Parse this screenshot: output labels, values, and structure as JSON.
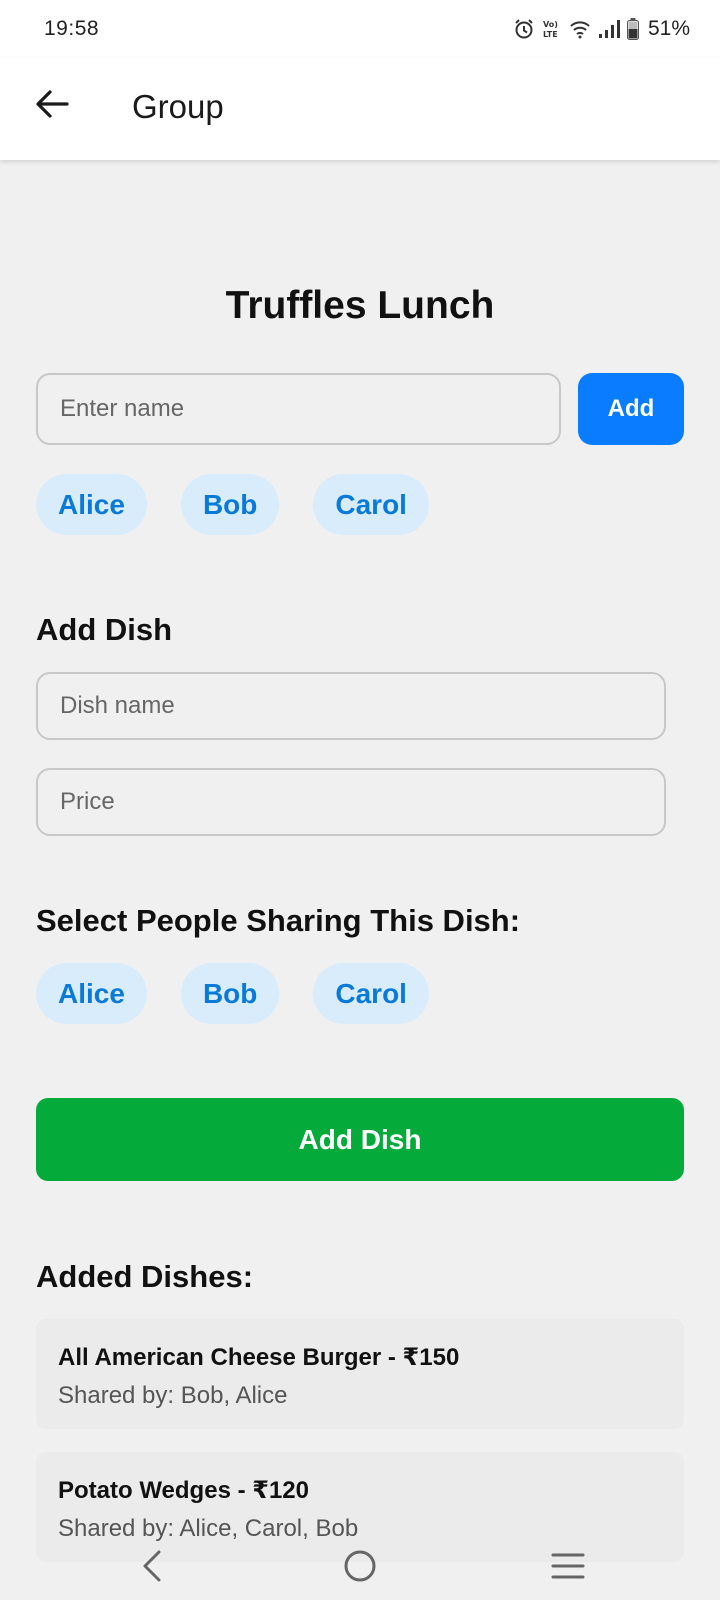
{
  "status_bar": {
    "time": "19:58",
    "battery_percent": "51%",
    "icons": [
      "alarm-icon",
      "volte-icon",
      "wifi-icon",
      "signal-icon",
      "battery-icon"
    ]
  },
  "app_bar": {
    "title": "Group",
    "back_icon": "arrow-left-icon"
  },
  "group": {
    "name": "Truffles Lunch",
    "name_input_placeholder": "Enter name",
    "add_label": "Add",
    "members": [
      "Alice",
      "Bob",
      "Carol"
    ]
  },
  "add_dish": {
    "heading": "Add Dish",
    "dish_name_placeholder": "Dish name",
    "price_placeholder": "Price",
    "share_heading": "Select People Sharing This Dish:",
    "share_people": [
      "Alice",
      "Bob",
      "Carol"
    ],
    "submit_label": "Add Dish"
  },
  "added_dishes": {
    "heading": "Added Dishes:",
    "items": [
      {
        "title": "All American Cheese Burger - ₹150",
        "shared": "Shared by: Bob, Alice"
      },
      {
        "title": "Potato Wedges - ₹120",
        "shared": "Shared by: Alice, Carol, Bob"
      }
    ]
  },
  "colors": {
    "primary_blue": "#0a7cff",
    "chip_bg": "#d9ecfb",
    "chip_text": "#0a7ad8",
    "green": "#04ab3a",
    "background": "#f0f0f0"
  },
  "nav_bar": {
    "icons": [
      "nav-back-icon",
      "nav-home-icon",
      "nav-recents-icon"
    ]
  }
}
